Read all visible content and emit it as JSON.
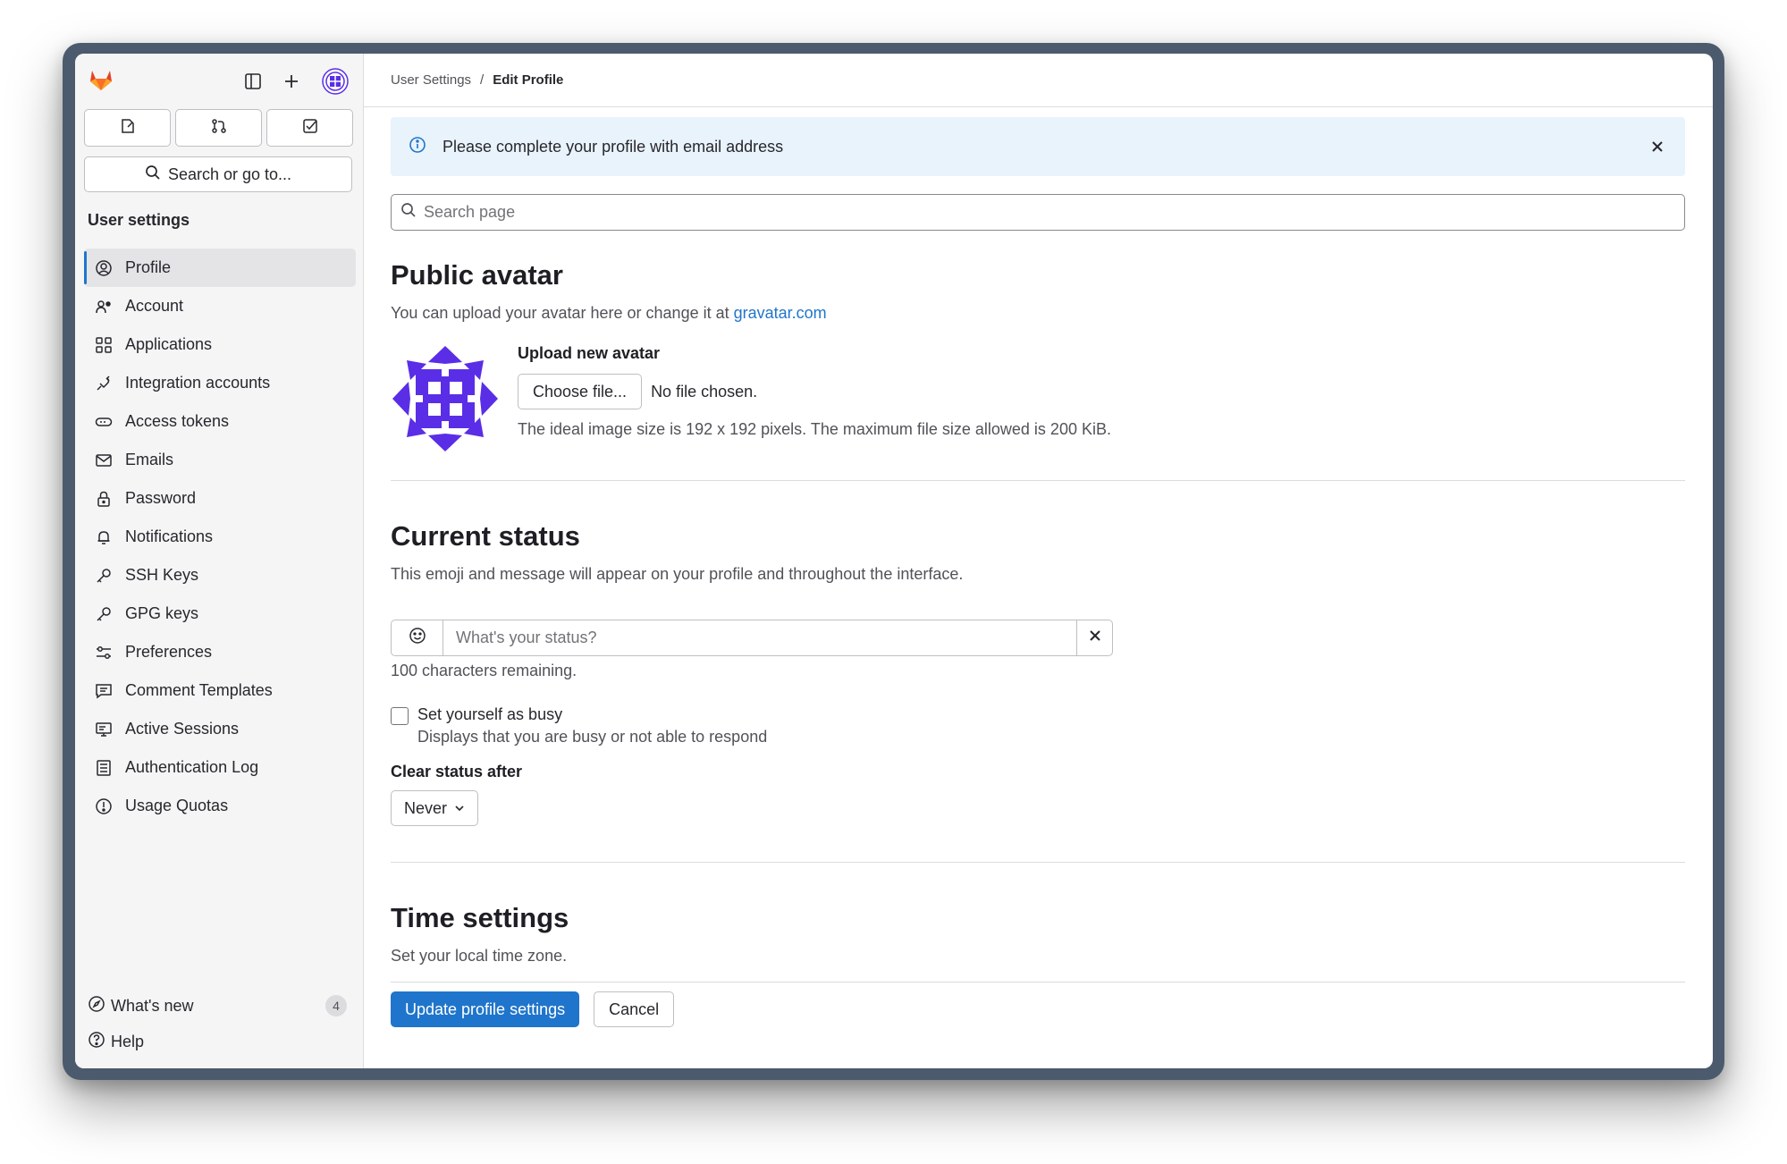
{
  "sidebar": {
    "search_label": "Search or go to...",
    "heading": "User settings",
    "items": [
      {
        "label": "Profile",
        "icon": "profile-icon",
        "active": true
      },
      {
        "label": "Account",
        "icon": "account-icon"
      },
      {
        "label": "Applications",
        "icon": "applications-icon"
      },
      {
        "label": "Integration accounts",
        "icon": "integration-icon"
      },
      {
        "label": "Access tokens",
        "icon": "token-icon"
      },
      {
        "label": "Emails",
        "icon": "mail-icon"
      },
      {
        "label": "Password",
        "icon": "lock-icon"
      },
      {
        "label": "Notifications",
        "icon": "bell-icon"
      },
      {
        "label": "SSH Keys",
        "icon": "key-icon"
      },
      {
        "label": "GPG keys",
        "icon": "key-icon"
      },
      {
        "label": "Preferences",
        "icon": "preferences-icon"
      },
      {
        "label": "Comment Templates",
        "icon": "comment-icon"
      },
      {
        "label": "Active Sessions",
        "icon": "monitor-icon"
      },
      {
        "label": "Authentication Log",
        "icon": "log-icon"
      },
      {
        "label": "Usage Quotas",
        "icon": "quota-icon"
      }
    ],
    "whats_new": "What's new",
    "whats_new_count": "4",
    "help": "Help"
  },
  "breadcrumb": {
    "parent": "User Settings",
    "separator": "/",
    "current": "Edit Profile"
  },
  "alert": {
    "message": "Please complete your profile with email address"
  },
  "page_search": {
    "placeholder": "Search page"
  },
  "public_avatar": {
    "title": "Public avatar",
    "desc_prefix": "You can upload your avatar here or change it at ",
    "desc_link": "gravatar.com",
    "upload_label": "Upload new avatar",
    "choose_button": "Choose file...",
    "no_file": "No file chosen.",
    "hint": "The ideal image size is 192 x 192 pixels. The maximum file size allowed is 200 KiB."
  },
  "current_status": {
    "title": "Current status",
    "desc": "This emoji and message will appear on your profile and throughout the interface.",
    "placeholder": "What's your status?",
    "remaining": "100 characters remaining.",
    "busy_label": "Set yourself as busy",
    "busy_help": "Displays that you are busy or not able to respond",
    "clear_label": "Clear status after",
    "clear_value": "Never"
  },
  "time_settings": {
    "title": "Time settings",
    "desc": "Set your local time zone."
  },
  "actions": {
    "update": "Update profile settings",
    "cancel": "Cancel"
  },
  "colors": {
    "accent": "#1f75cb",
    "avatar": "#5a2ee6",
    "alert_bg": "#e9f3fc",
    "logo_orange": "#fc6d26"
  }
}
